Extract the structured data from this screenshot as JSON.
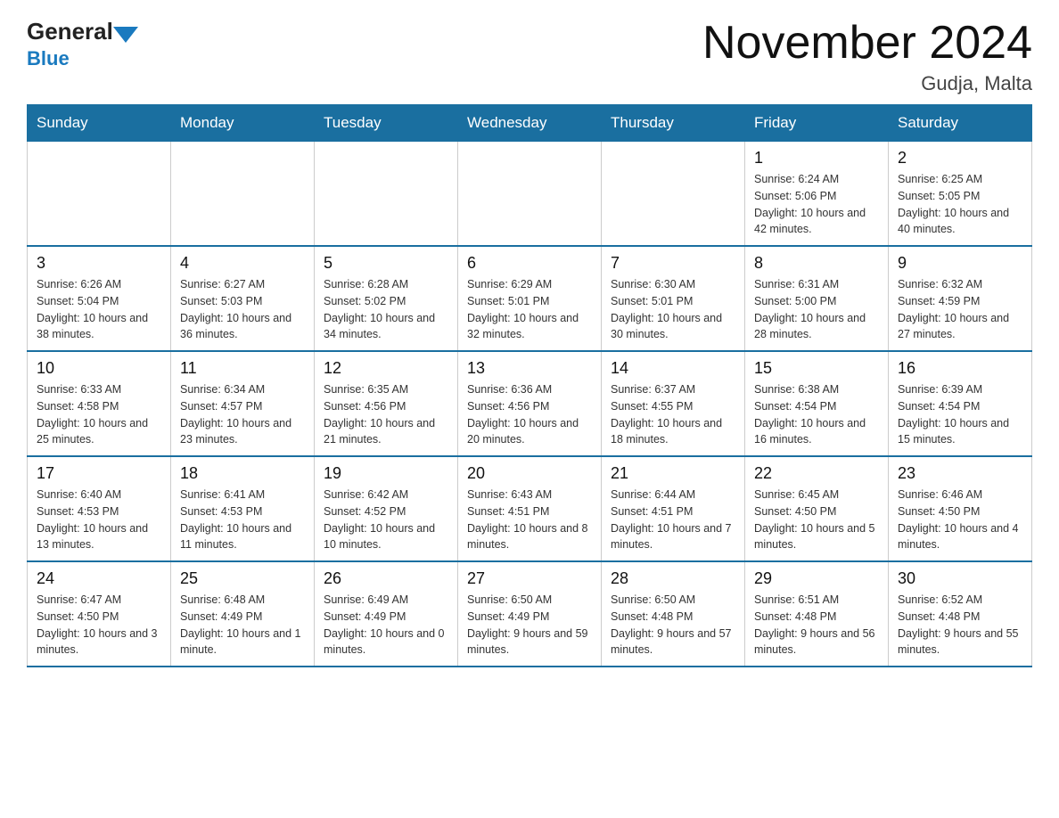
{
  "header": {
    "logo_general": "General",
    "logo_blue": "Blue",
    "title": "November 2024",
    "subtitle": "Gudja, Malta"
  },
  "calendar": {
    "days_of_week": [
      "Sunday",
      "Monday",
      "Tuesday",
      "Wednesday",
      "Thursday",
      "Friday",
      "Saturday"
    ],
    "weeks": [
      [
        {
          "day": "",
          "info": ""
        },
        {
          "day": "",
          "info": ""
        },
        {
          "day": "",
          "info": ""
        },
        {
          "day": "",
          "info": ""
        },
        {
          "day": "",
          "info": ""
        },
        {
          "day": "1",
          "info": "Sunrise: 6:24 AM\nSunset: 5:06 PM\nDaylight: 10 hours and 42 minutes."
        },
        {
          "day": "2",
          "info": "Sunrise: 6:25 AM\nSunset: 5:05 PM\nDaylight: 10 hours and 40 minutes."
        }
      ],
      [
        {
          "day": "3",
          "info": "Sunrise: 6:26 AM\nSunset: 5:04 PM\nDaylight: 10 hours and 38 minutes."
        },
        {
          "day": "4",
          "info": "Sunrise: 6:27 AM\nSunset: 5:03 PM\nDaylight: 10 hours and 36 minutes."
        },
        {
          "day": "5",
          "info": "Sunrise: 6:28 AM\nSunset: 5:02 PM\nDaylight: 10 hours and 34 minutes."
        },
        {
          "day": "6",
          "info": "Sunrise: 6:29 AM\nSunset: 5:01 PM\nDaylight: 10 hours and 32 minutes."
        },
        {
          "day": "7",
          "info": "Sunrise: 6:30 AM\nSunset: 5:01 PM\nDaylight: 10 hours and 30 minutes."
        },
        {
          "day": "8",
          "info": "Sunrise: 6:31 AM\nSunset: 5:00 PM\nDaylight: 10 hours and 28 minutes."
        },
        {
          "day": "9",
          "info": "Sunrise: 6:32 AM\nSunset: 4:59 PM\nDaylight: 10 hours and 27 minutes."
        }
      ],
      [
        {
          "day": "10",
          "info": "Sunrise: 6:33 AM\nSunset: 4:58 PM\nDaylight: 10 hours and 25 minutes."
        },
        {
          "day": "11",
          "info": "Sunrise: 6:34 AM\nSunset: 4:57 PM\nDaylight: 10 hours and 23 minutes."
        },
        {
          "day": "12",
          "info": "Sunrise: 6:35 AM\nSunset: 4:56 PM\nDaylight: 10 hours and 21 minutes."
        },
        {
          "day": "13",
          "info": "Sunrise: 6:36 AM\nSunset: 4:56 PM\nDaylight: 10 hours and 20 minutes."
        },
        {
          "day": "14",
          "info": "Sunrise: 6:37 AM\nSunset: 4:55 PM\nDaylight: 10 hours and 18 minutes."
        },
        {
          "day": "15",
          "info": "Sunrise: 6:38 AM\nSunset: 4:54 PM\nDaylight: 10 hours and 16 minutes."
        },
        {
          "day": "16",
          "info": "Sunrise: 6:39 AM\nSunset: 4:54 PM\nDaylight: 10 hours and 15 minutes."
        }
      ],
      [
        {
          "day": "17",
          "info": "Sunrise: 6:40 AM\nSunset: 4:53 PM\nDaylight: 10 hours and 13 minutes."
        },
        {
          "day": "18",
          "info": "Sunrise: 6:41 AM\nSunset: 4:53 PM\nDaylight: 10 hours and 11 minutes."
        },
        {
          "day": "19",
          "info": "Sunrise: 6:42 AM\nSunset: 4:52 PM\nDaylight: 10 hours and 10 minutes."
        },
        {
          "day": "20",
          "info": "Sunrise: 6:43 AM\nSunset: 4:51 PM\nDaylight: 10 hours and 8 minutes."
        },
        {
          "day": "21",
          "info": "Sunrise: 6:44 AM\nSunset: 4:51 PM\nDaylight: 10 hours and 7 minutes."
        },
        {
          "day": "22",
          "info": "Sunrise: 6:45 AM\nSunset: 4:50 PM\nDaylight: 10 hours and 5 minutes."
        },
        {
          "day": "23",
          "info": "Sunrise: 6:46 AM\nSunset: 4:50 PM\nDaylight: 10 hours and 4 minutes."
        }
      ],
      [
        {
          "day": "24",
          "info": "Sunrise: 6:47 AM\nSunset: 4:50 PM\nDaylight: 10 hours and 3 minutes."
        },
        {
          "day": "25",
          "info": "Sunrise: 6:48 AM\nSunset: 4:49 PM\nDaylight: 10 hours and 1 minute."
        },
        {
          "day": "26",
          "info": "Sunrise: 6:49 AM\nSunset: 4:49 PM\nDaylight: 10 hours and 0 minutes."
        },
        {
          "day": "27",
          "info": "Sunrise: 6:50 AM\nSunset: 4:49 PM\nDaylight: 9 hours and 59 minutes."
        },
        {
          "day": "28",
          "info": "Sunrise: 6:50 AM\nSunset: 4:48 PM\nDaylight: 9 hours and 57 minutes."
        },
        {
          "day": "29",
          "info": "Sunrise: 6:51 AM\nSunset: 4:48 PM\nDaylight: 9 hours and 56 minutes."
        },
        {
          "day": "30",
          "info": "Sunrise: 6:52 AM\nSunset: 4:48 PM\nDaylight: 9 hours and 55 minutes."
        }
      ]
    ]
  }
}
